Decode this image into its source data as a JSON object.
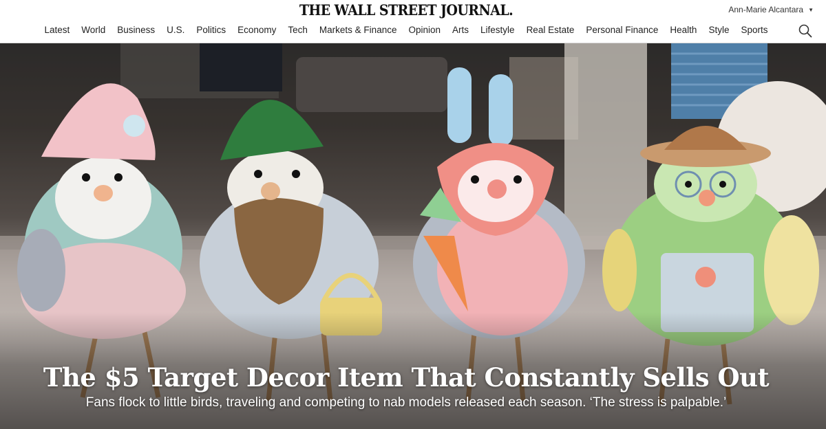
{
  "header": {
    "masthead": "THE WALL STREET JOURNAL.",
    "user_name": "Ann-Marie Alcantara",
    "nav": [
      "Latest",
      "World",
      "Business",
      "U.S.",
      "Politics",
      "Economy",
      "Tech",
      "Markets & Finance",
      "Opinion",
      "Arts",
      "Lifestyle",
      "Real Estate",
      "Personal Finance",
      "Health",
      "Style",
      "Sports"
    ],
    "search_icon": "search-icon"
  },
  "hero": {
    "image_subject": "four felt Easter bird figurines",
    "headline": "The $5 Target Decor Item That Constantly Sells Out",
    "dek": "Fans flock to little birds, traveling and competing to nab models released each season. ‘The stress is palpable.’"
  }
}
